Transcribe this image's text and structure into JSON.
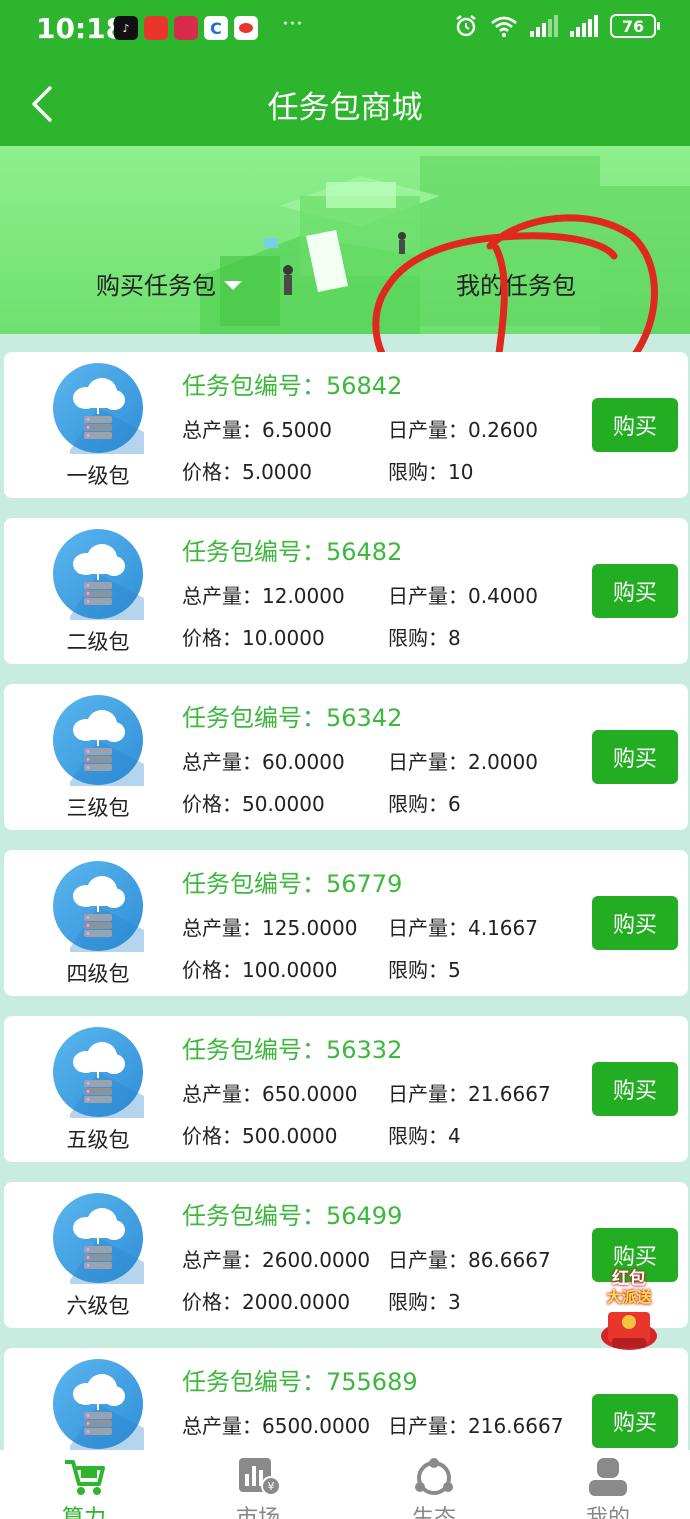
{
  "status_bar": {
    "time": "10:18",
    "battery": "76",
    "more": "···"
  },
  "header": {
    "title": "任务包商城"
  },
  "tabs": {
    "buy": "购买任务包",
    "mine": "我的任务包"
  },
  "packages": [
    {
      "no_label": "任务包编号：",
      "no": "56842",
      "level": "一级包",
      "total_label": "总产量：",
      "total": "6.5000",
      "daily_label": "日产量：",
      "daily": "0.2600",
      "price_label": "价格：",
      "price": "5.0000",
      "limit_label": "限购：",
      "limit": "10",
      "button": "购买"
    },
    {
      "no_label": "任务包编号：",
      "no": "56482",
      "level": "二级包",
      "total_label": "总产量：",
      "total": "12.0000",
      "daily_label": "日产量：",
      "daily": "0.4000",
      "price_label": "价格：",
      "price": "10.0000",
      "limit_label": "限购：",
      "limit": "8",
      "button": "购买"
    },
    {
      "no_label": "任务包编号：",
      "no": "56342",
      "level": "三级包",
      "total_label": "总产量：",
      "total": "60.0000",
      "daily_label": "日产量：",
      "daily": "2.0000",
      "price_label": "价格：",
      "price": "50.0000",
      "limit_label": "限购：",
      "limit": "6",
      "button": "购买"
    },
    {
      "no_label": "任务包编号：",
      "no": "56779",
      "level": "四级包",
      "total_label": "总产量：",
      "total": "125.0000",
      "daily_label": "日产量：",
      "daily": "4.1667",
      "price_label": "价格：",
      "price": "100.0000",
      "limit_label": "限购：",
      "limit": "5",
      "button": "购买"
    },
    {
      "no_label": "任务包编号：",
      "no": "56332",
      "level": "五级包",
      "total_label": "总产量：",
      "total": "650.0000",
      "daily_label": "日产量：",
      "daily": "21.6667",
      "price_label": "价格：",
      "price": "500.0000",
      "limit_label": "限购：",
      "limit": "4",
      "button": "购买"
    },
    {
      "no_label": "任务包编号：",
      "no": "56499",
      "level": "六级包",
      "total_label": "总产量：",
      "total": "2600.0000",
      "daily_label": "日产量：",
      "daily": "86.6667",
      "price_label": "价格：",
      "price": "2000.0000",
      "limit_label": "限购：",
      "limit": "3",
      "button": "购买"
    },
    {
      "no_label": "任务包编号：",
      "no": "755689",
      "level": "",
      "total_label": "总产量：",
      "total": "6500.0000",
      "daily_label": "日产量：",
      "daily": "216.6667",
      "price_label": "",
      "price": "",
      "limit_label": "",
      "limit": "",
      "button": "购买"
    }
  ],
  "redpacket": {
    "line1": "红包",
    "line2": "大派送"
  },
  "tabbar": [
    {
      "label": "算力",
      "icon": "cart-icon"
    },
    {
      "label": "市场",
      "icon": "market-chart-icon"
    },
    {
      "label": "生态",
      "icon": "share-network-icon"
    },
    {
      "label": "我的",
      "icon": "user-icon"
    }
  ],
  "colors": {
    "primary": "#2db52d",
    "button": "#22ad22",
    "package_no": "#3cb83c",
    "annotation": "#e0281e",
    "page_bg": "#c8ede0"
  }
}
